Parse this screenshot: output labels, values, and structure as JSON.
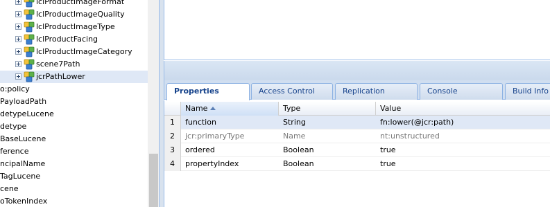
{
  "tree": {
    "children": [
      {
        "label": "lclProductImageFormat"
      },
      {
        "label": "lclProductImageQuality"
      },
      {
        "label": "lclProductImageType"
      },
      {
        "label": "lclProductFacing"
      },
      {
        "label": "lclProductImageCategory"
      },
      {
        "label": "scene7Path"
      },
      {
        "label": "jcrPathLower"
      }
    ],
    "siblings": [
      {
        "label": "o:policy"
      },
      {
        "label": "PayloadPath"
      },
      {
        "label": "detypeLucene"
      },
      {
        "label": "detype"
      },
      {
        "label": "BaseLucene"
      },
      {
        "label": "ference"
      },
      {
        "label": "ncipalName"
      },
      {
        "label": "TagLucene"
      },
      {
        "label": "cene"
      },
      {
        "label": "oTokenIndex"
      }
    ]
  },
  "tabs": [
    "Properties",
    "Access Control",
    "Replication",
    "Console",
    "Build Info"
  ],
  "grid": {
    "headers": {
      "name": "Name",
      "type": "Type",
      "value": "Value"
    },
    "rows": [
      {
        "num": "1",
        "name": "function",
        "type": "String",
        "value": "fn:lower(@jcr:path)"
      },
      {
        "num": "2",
        "name": "jcr:primaryType",
        "type": "Name",
        "value": "nt:unstructured"
      },
      {
        "num": "3",
        "name": "ordered",
        "type": "Boolean",
        "value": "true"
      },
      {
        "num": "4",
        "name": "propertyIndex",
        "type": "Boolean",
        "value": "true"
      }
    ]
  },
  "colors": {
    "accent": "#15428b",
    "selection": "#dfe8f6",
    "border": "#99bbe8"
  },
  "icons": {
    "tree_node": "node-icon",
    "tree_toggle": "expand-icon",
    "sort": "sort-ascending-icon"
  }
}
